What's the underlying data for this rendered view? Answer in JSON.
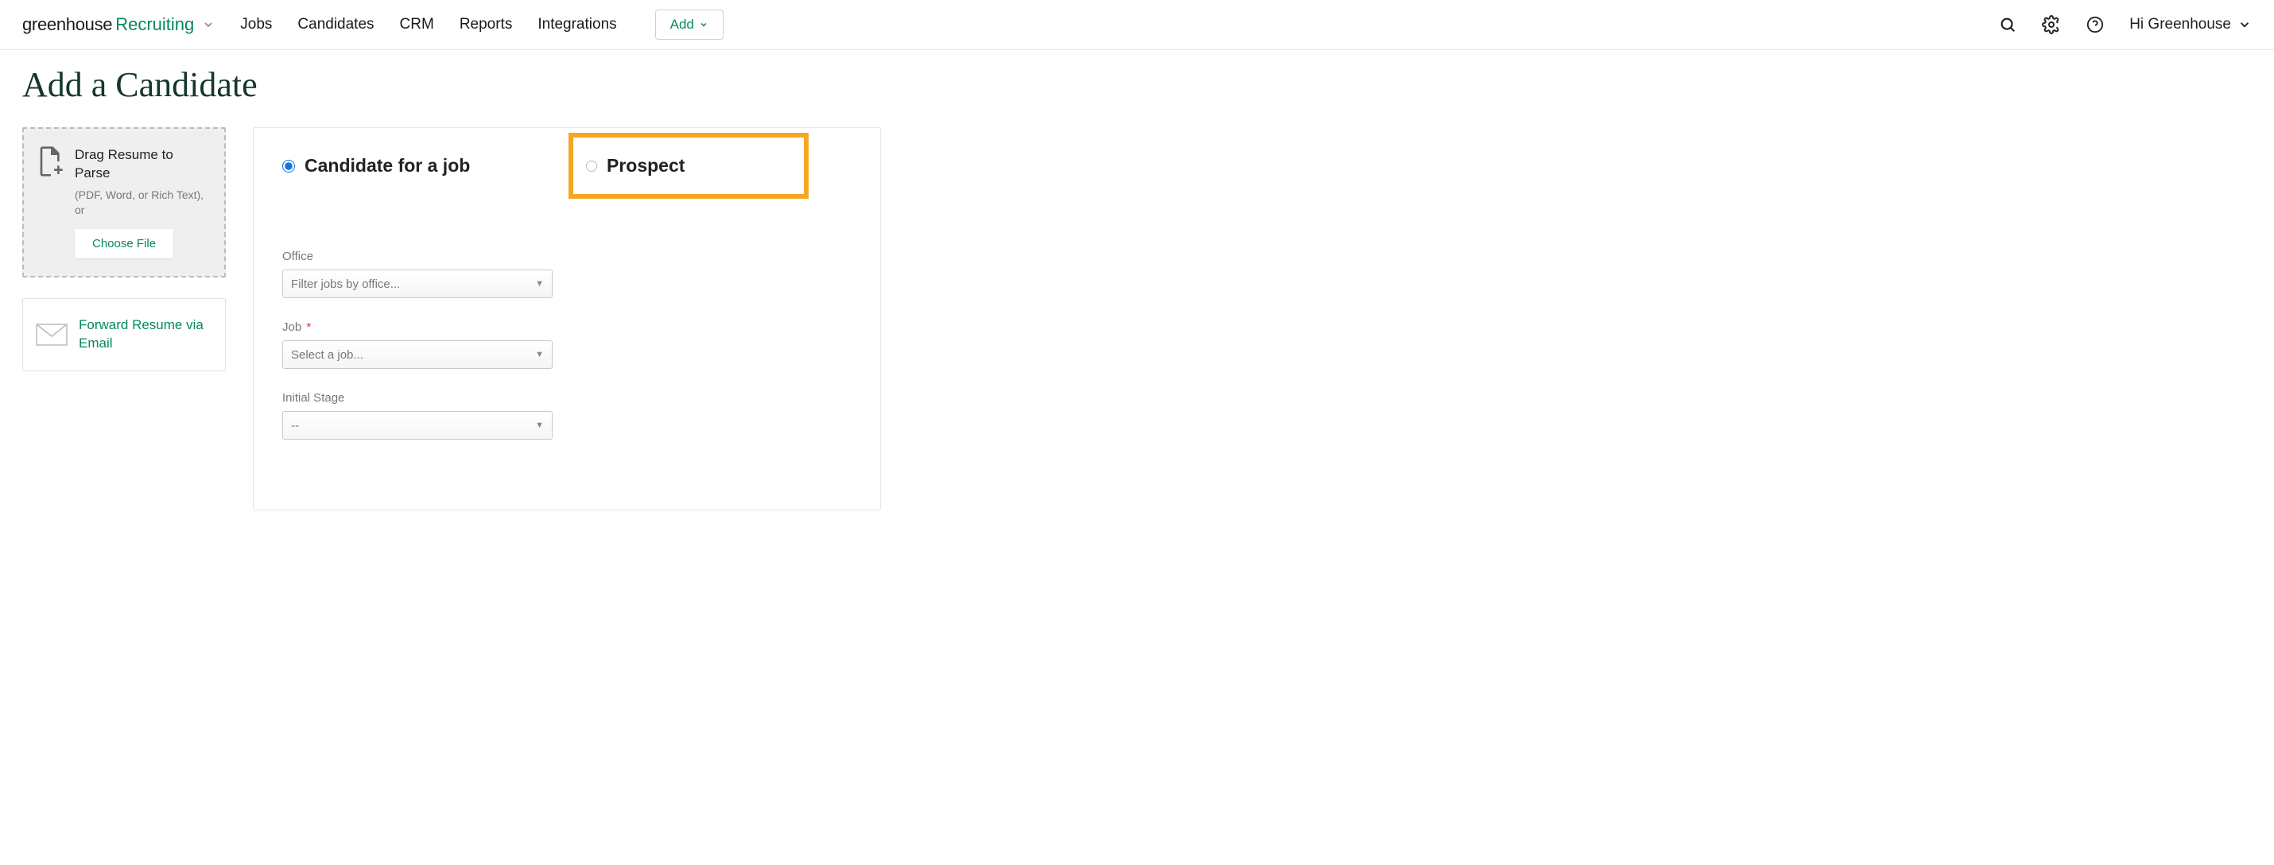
{
  "brand": {
    "word1": "greenhouse",
    "word2": "Recruiting"
  },
  "nav": {
    "jobs": "Jobs",
    "candidates": "Candidates",
    "crm": "CRM",
    "reports": "Reports",
    "integrations": "Integrations",
    "add": "Add",
    "user_greeting": "Hi Greenhouse"
  },
  "page": {
    "title": "Add a Candidate"
  },
  "drop": {
    "title": "Drag Resume to Parse",
    "hint": "(PDF, Word, or Rich Text), or",
    "choose": "Choose File"
  },
  "forward": {
    "label": "Forward Resume via Email"
  },
  "radios": {
    "candidate": "Candidate for a job",
    "prospect": "Prospect"
  },
  "fields": {
    "office": {
      "label": "Office",
      "placeholder": "Filter jobs by office..."
    },
    "job": {
      "label": "Job",
      "required": "*",
      "placeholder": "Select a job..."
    },
    "stage": {
      "label": "Initial Stage",
      "placeholder": "--"
    }
  }
}
